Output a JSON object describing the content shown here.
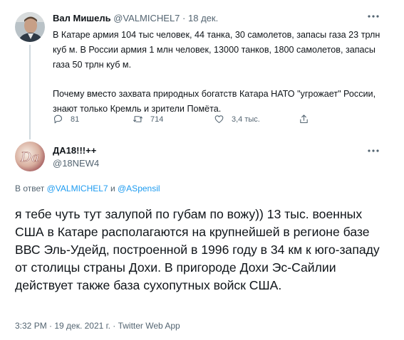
{
  "parent_tweet": {
    "display_name": "Вал Мишель",
    "handle": "@VALMICHEL7",
    "separator": "·",
    "date": "18 дек.",
    "paragraph_1": "В Катаре армия 104 тыс человек, 44 танка, 30 самолетов, запасы газа 23 трлн куб м. В России армия 1 млн человек, 13000 танков, 1800 самолетов, запасы газа 50 трлн куб м.",
    "paragraph_2": "Почему вместо захвата природных богатств Катара НАТО \"угрожает\" России, знают только Кремль и зрители Помёта.",
    "replies_count": "81",
    "retweets_count": "714",
    "likes_count": "3,4 тыс."
  },
  "reply_tweet": {
    "display_name": "ДА18!!!++",
    "handle": "@18NEW4",
    "avatar_text": "Da",
    "reply_prefix": "В ответ",
    "reply_user_1": "@VALMICHEL7",
    "reply_conj": "и",
    "reply_user_2": "@ASpensil",
    "text": "я тебе чуть тут залупой по губам по вожу)) 13 тыс. военных США в Катаре располагаются на крупнейшей в регионе базе ВВС Эль-Удейд, построенной в 1996 году в 34 км к юго-западу от столицы страны Дохи. В пригороде Дохи Эс-Сайлии действует также база сухопутных войск США.",
    "timestamp": "3:32 PM · 19 дек. 2021 г. · Twitter Web App"
  },
  "icons": {
    "reply": "reply-icon",
    "retweet": "retweet-icon",
    "like": "heart-icon",
    "share": "share-icon",
    "more": "more-icon"
  },
  "colors": {
    "text": "#0f1419",
    "secondary": "#536471",
    "link": "#1d9bf0",
    "thread_line": "#cfd9de"
  }
}
